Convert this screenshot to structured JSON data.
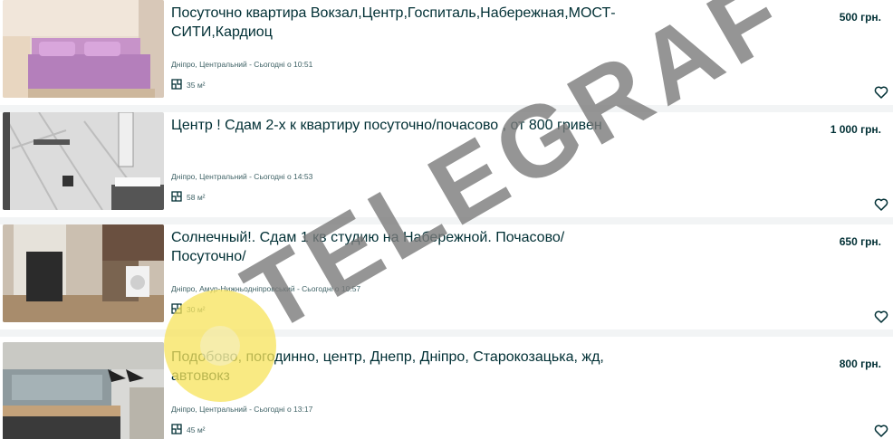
{
  "listings": [
    {
      "title": "Посуточно квартира Вокзал,Центр,Госпиталь,Набережная,МОСТ-СИТИ,Кардиоц",
      "price": "500 грн.",
      "location_date": "Дніпро, Центральний - Сьогодні о 10:51",
      "area": "35 м²",
      "favorite_icon": "heart-outline-icon"
    },
    {
      "title": "Центр ! Сдам 2-х к квартиру посуточно/почасово , от 800 гривен",
      "price": "1 000 грн.",
      "location_date": "Дніпро, Центральний - Сьогодні о 14:53",
      "area": "58 м²",
      "favorite_icon": "heart-outline-icon"
    },
    {
      "title": "Солнечный!. Сдам 1 кв студию на Набережной. Почасово/ Посуточно/",
      "price": "650 грн.",
      "location_date": "Дніпро, Амур-Нижньодніпровський - Сьогодні о 10:57",
      "area": "30 м²",
      "favorite_icon": "heart-outline-icon"
    },
    {
      "title": "Подобово, погодинно, центр, Днепр, Дніпро, Старокозацька, жд, автовокз",
      "price": "800 грн.",
      "location_date": "Дніпро, Центральний - Сьогодні о 13:17",
      "area": "45 м²",
      "favorite_icon": "heart-outline-icon"
    }
  ],
  "watermark": {
    "text": "TELEGRAF",
    "color": "#7a7a7a",
    "logo_color": "#f7e35a"
  },
  "colors": {
    "text": "#002f34",
    "meta": "#406367",
    "background": "#f2f4f5"
  }
}
